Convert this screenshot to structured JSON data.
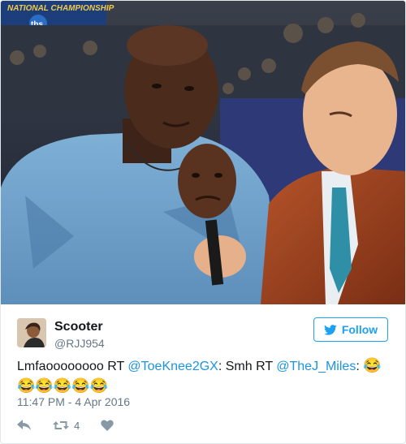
{
  "tweet": {
    "author": {
      "display_name": "Scooter",
      "handle": "@RJJ954"
    },
    "follow_label": "Follow",
    "text": {
      "lead": "Lmfaoooooooo RT ",
      "mention_1": "@ToeKnee2GX",
      "middle": ": Smh RT ",
      "mention_2": "@TheJ_Miles",
      "after_mention": ": ",
      "emoji_end_line1": "😂",
      "emoji_line2": "😂😂😂😂😂"
    },
    "timestamp": "11:47 PM - 4 Apr 2016",
    "actions": {
      "reply_icon": "reply-icon",
      "retweet_icon": "retweet-icon",
      "retweet_count": "4",
      "like_icon": "heart-icon"
    }
  },
  "media": {
    "banner_text": "NATIONAL CHAMPIONSHIP",
    "network_logo": "tbs"
  },
  "colors": {
    "accent": "#1da1f2",
    "link": "#1b95e0",
    "muted": "#657786",
    "icon": "#8899a6"
  }
}
